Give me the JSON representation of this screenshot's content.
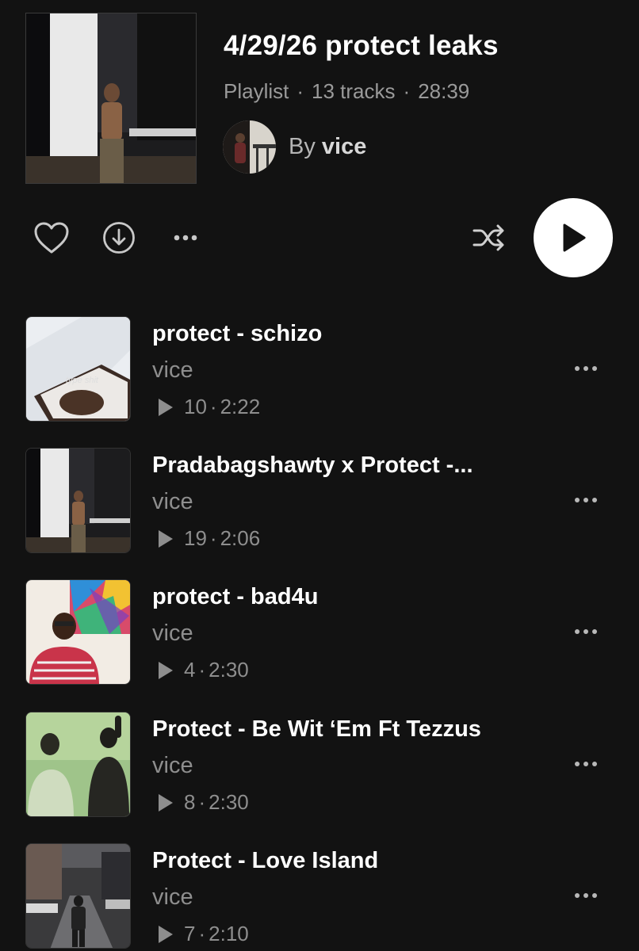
{
  "playlist": {
    "title": "4/29/26 protect leaks",
    "type": "Playlist",
    "track_count": "13 tracks",
    "duration": "28:39",
    "separator": "·",
    "by_prefix": "By",
    "owner": "vice"
  },
  "controls": {
    "like_icon": "heart-outline-icon",
    "download_icon": "download-circle-icon",
    "more_icon": "more-horizontal-icon",
    "shuffle_icon": "shuffle-icon",
    "play_icon": "play-icon"
  },
  "tracks": [
    {
      "title": "protect  -  schizo",
      "artist": "vice",
      "plays": "10",
      "sep": "·",
      "duration": "2:22",
      "thumb_caption": "type shit"
    },
    {
      "title": "Pradabagshawty  x Protect  -...",
      "artist": "vice",
      "plays": "19",
      "sep": "·",
      "duration": "2:06",
      "thumb_caption": ""
    },
    {
      "title": "protect  -  bad4u",
      "artist": "vice",
      "plays": "4",
      "sep": "·",
      "duration": "2:30",
      "thumb_caption": ""
    },
    {
      "title": "Protect  -  Be Wit ‘Em Ft Tezzus",
      "artist": "vice",
      "plays": "8",
      "sep": "·",
      "duration": "2:30",
      "thumb_caption": ""
    },
    {
      "title": "Protect  -  Love Island",
      "artist": "vice",
      "plays": "7",
      "sep": "·",
      "duration": "2:10",
      "thumb_caption": ""
    }
  ],
  "colors": {
    "background": "#121212",
    "primary_text": "#ffffff",
    "secondary_text": "#8e8e8e",
    "play_button": "#ffffff"
  }
}
